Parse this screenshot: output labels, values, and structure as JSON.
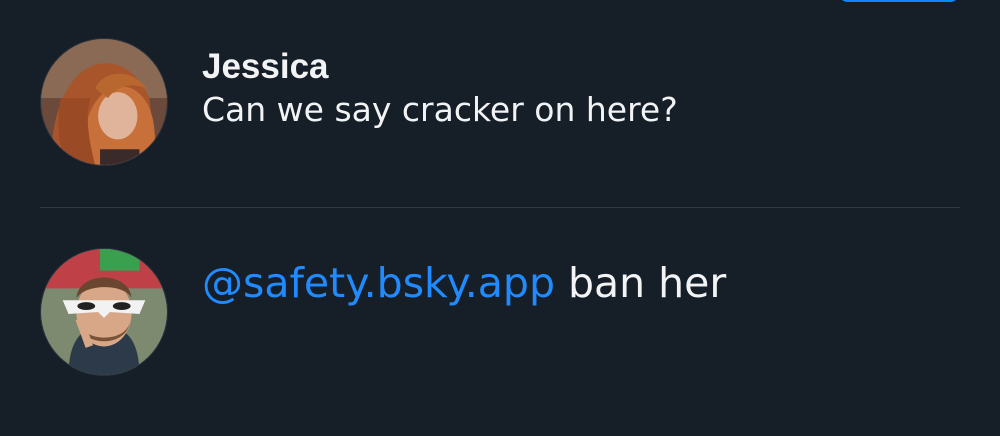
{
  "posts": [
    {
      "author": "Jessica",
      "text": "Can we say cracker on here?"
    },
    {
      "mention": "@safety.bsky.app",
      "text": " ban her"
    }
  ],
  "colors": {
    "background": "#161e27",
    "text": "#f1f3f5",
    "mention": "#208bfe",
    "accent_button": "#1083fe",
    "divider": "#2e3a46"
  }
}
